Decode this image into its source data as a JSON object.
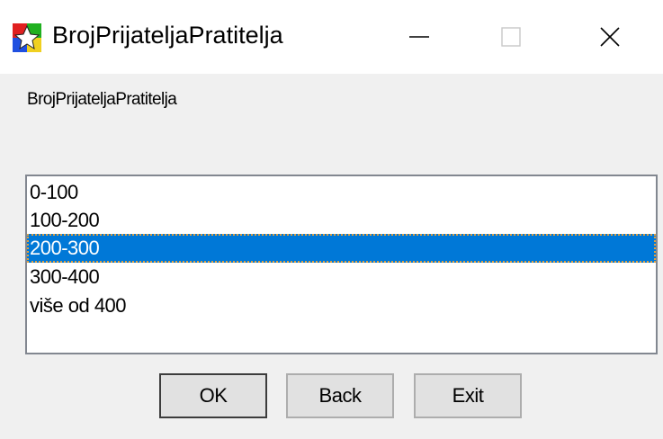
{
  "window": {
    "title": "BrojPrijateljaPratitelja",
    "icon": "app-icon"
  },
  "titlebar_buttons": {
    "minimize": "minimize-icon",
    "maximize": "maximize-icon",
    "close": "close-icon"
  },
  "content": {
    "label": "BrojPrijateljaPratitelja"
  },
  "list": {
    "items": [
      {
        "label": "0-100",
        "selected": false
      },
      {
        "label": "100-200",
        "selected": false
      },
      {
        "label": "200-300",
        "selected": true
      },
      {
        "label": "300-400",
        "selected": false
      },
      {
        "label": "više od 400",
        "selected": false
      }
    ]
  },
  "buttons": {
    "ok": "OK",
    "back": "Back",
    "exit": "Exit"
  },
  "colors": {
    "selection": "#0078d7",
    "window_bg": "#f0f0f0"
  }
}
